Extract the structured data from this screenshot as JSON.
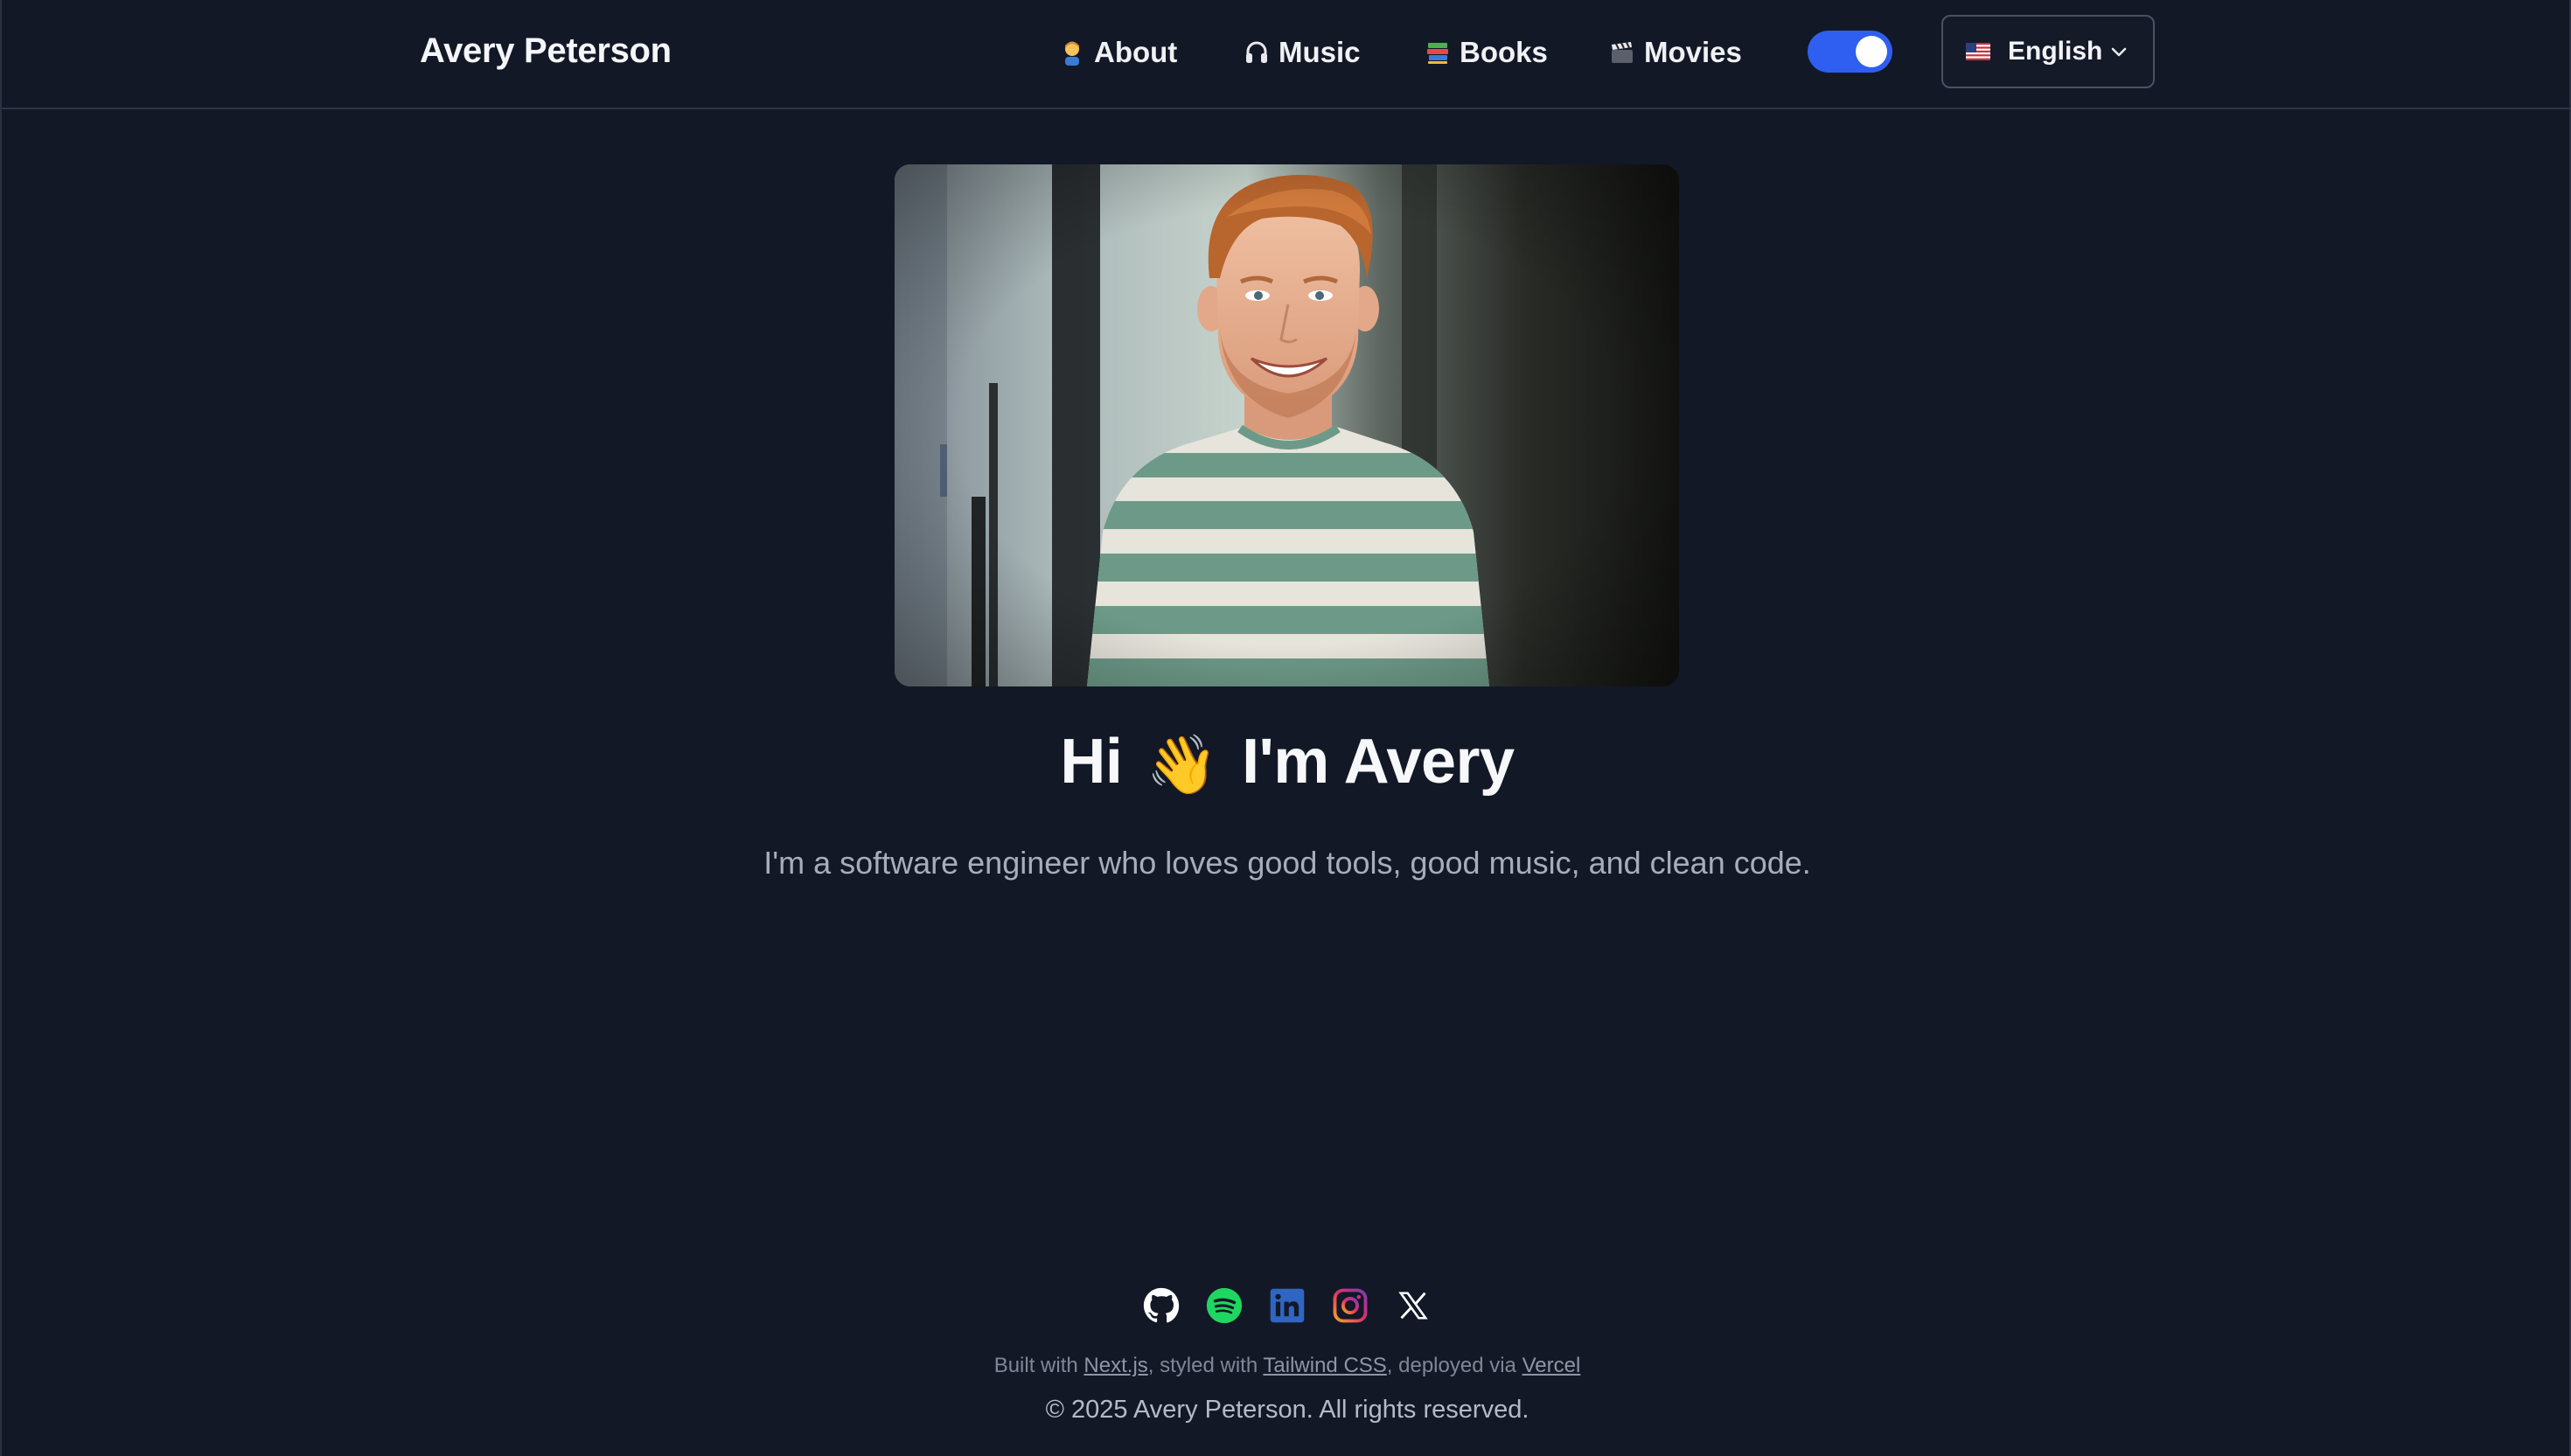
{
  "header": {
    "brand": "Avery Peterson",
    "nav": [
      {
        "label": "About",
        "icon": "person-emoji-icon"
      },
      {
        "label": "Music",
        "icon": "headphones-icon"
      },
      {
        "label": "Books",
        "icon": "books-emoji-icon"
      },
      {
        "label": "Movies",
        "icon": "clapper-board-icon"
      }
    ],
    "theme_toggle": {
      "state": "on",
      "color": "#2f5ff0"
    },
    "language": {
      "label": "English",
      "flag": "us-flag-icon"
    }
  },
  "hero": {
    "title_before": "Hi",
    "wave": "👋",
    "title_after": "I'm Avery",
    "tagline": "I'm a software engineer who loves good tools, good music, and clean code."
  },
  "footer": {
    "socials": [
      "github-icon",
      "spotify-icon",
      "linkedin-icon",
      "instagram-icon",
      "x-icon"
    ],
    "built_prefix": "Built with",
    "built_nextjs": "Next.js",
    "built_mid1": ", styled with",
    "built_tailwind": "Tailwind CSS",
    "built_mid2": ", deployed via",
    "built_vercel": "Vercel",
    "copyright": "© 2025 Avery Peterson. All rights reserved."
  },
  "colors": {
    "background": "#131827",
    "accent": "#2f5ff0",
    "spotify": "#1ed760",
    "linkedin": "#2f66c2"
  }
}
